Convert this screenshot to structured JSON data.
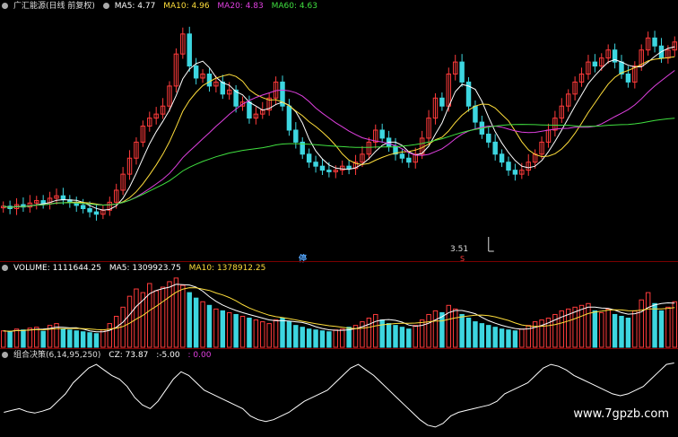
{
  "price_panel": {
    "title": "广汇能源(日线 前复权)",
    "ma": [
      {
        "label": "MA5: 4.77",
        "color": "#ffffff"
      },
      {
        "label": "MA10: 4.96",
        "color": "#ffde3b"
      },
      {
        "label": "MA20: 4.83",
        "color": "#e040e0"
      },
      {
        "label": "MA60: 4.63",
        "color": "#40e040"
      }
    ],
    "low_label": "3.51",
    "tag": "停",
    "small_tag": "S"
  },
  "volume_panel": {
    "items": [
      {
        "label": "VOLUME: 1111644.25",
        "color": "#ffffff"
      },
      {
        "label": "MA5: 1309923.75",
        "color": "#ffffff"
      },
      {
        "label": "MA10: 1378912.25",
        "color": "#ffde3b"
      }
    ]
  },
  "osc_panel": {
    "title": "组合决策(6,14,95,250)",
    "items": [
      {
        "label": "CZ: 73.87",
        "color": "#ffffff"
      },
      {
        "label": ":-5.00",
        "color": "#ffffff"
      },
      {
        "label": ": 0.00",
        "color": "#e040e0"
      }
    ]
  },
  "watermark": "www.7gpzb.com",
  "chart_data": {
    "type": "candlestick",
    "series_colors": {
      "up": "#ff3b3b",
      "down": "#3dd6e0",
      "ma5": "#ffffff",
      "ma10": "#ffde3b",
      "ma20": "#e040e0",
      "ma60": "#40e040",
      "cz": "#ffffff"
    },
    "close": [
      3.95,
      3.92,
      3.97,
      3.94,
      3.99,
      4.02,
      3.98,
      4.05,
      4.08,
      4.03,
      4.0,
      3.96,
      3.92,
      3.88,
      3.85,
      3.9,
      4.0,
      4.15,
      4.35,
      4.55,
      4.75,
      4.95,
      5.05,
      5.1,
      5.2,
      5.45,
      5.85,
      6.1,
      5.7,
      5.55,
      5.6,
      5.45,
      5.5,
      5.35,
      5.4,
      5.2,
      5.25,
      5.05,
      5.1,
      5.15,
      5.3,
      5.5,
      5.2,
      4.9,
      4.75,
      4.6,
      4.5,
      4.45,
      4.4,
      4.38,
      4.4,
      4.45,
      4.42,
      4.5,
      4.6,
      4.75,
      4.9,
      4.8,
      4.7,
      4.6,
      4.55,
      4.5,
      4.6,
      4.8,
      5.05,
      5.3,
      5.2,
      5.6,
      5.75,
      5.5,
      5.2,
      5.0,
      4.85,
      4.75,
      4.6,
      4.5,
      4.4,
      4.35,
      4.4,
      4.5,
      4.6,
      4.75,
      4.9,
      5.05,
      5.2,
      5.35,
      5.5,
      5.6,
      5.75,
      5.7,
      5.8,
      5.9,
      5.75,
      5.6,
      5.5,
      5.7,
      5.9,
      6.05,
      5.95,
      5.8,
      5.9,
      6.0
    ],
    "volume": [
      90,
      85,
      100,
      95,
      105,
      110,
      88,
      120,
      130,
      100,
      95,
      90,
      85,
      80,
      75,
      95,
      130,
      170,
      220,
      280,
      320,
      300,
      350,
      310,
      330,
      360,
      380,
      340,
      300,
      270,
      250,
      230,
      210,
      200,
      190,
      180,
      170,
      160,
      150,
      140,
      130,
      150,
      160,
      140,
      120,
      110,
      100,
      95,
      90,
      85,
      95,
      100,
      110,
      120,
      140,
      160,
      180,
      150,
      130,
      120,
      110,
      100,
      120,
      150,
      180,
      200,
      190,
      230,
      210,
      180,
      160,
      140,
      130,
      120,
      110,
      100,
      95,
      90,
      100,
      120,
      140,
      150,
      160,
      180,
      200,
      210,
      220,
      230,
      240,
      200,
      190,
      210,
      180,
      170,
      160,
      200,
      260,
      300,
      240,
      200,
      220,
      250
    ],
    "cz": [
      -60,
      -55,
      -50,
      -58,
      -62,
      -57,
      -50,
      -30,
      -10,
      20,
      40,
      60,
      70,
      55,
      40,
      30,
      10,
      -20,
      -40,
      -50,
      -30,
      0,
      30,
      50,
      40,
      20,
      0,
      -10,
      -20,
      -30,
      -40,
      -50,
      -70,
      -80,
      -85,
      -80,
      -70,
      -60,
      -45,
      -30,
      -20,
      -10,
      0,
      20,
      40,
      60,
      70,
      55,
      40,
      20,
      0,
      -20,
      -40,
      -60,
      -80,
      -95,
      -100,
      -90,
      -70,
      -60,
      -55,
      -50,
      -45,
      -40,
      -30,
      -10,
      0,
      10,
      20,
      40,
      60,
      70,
      65,
      55,
      40,
      30,
      20,
      10,
      0,
      -10,
      -15,
      -10,
      0,
      10,
      30,
      50,
      70,
      73.87
    ]
  }
}
